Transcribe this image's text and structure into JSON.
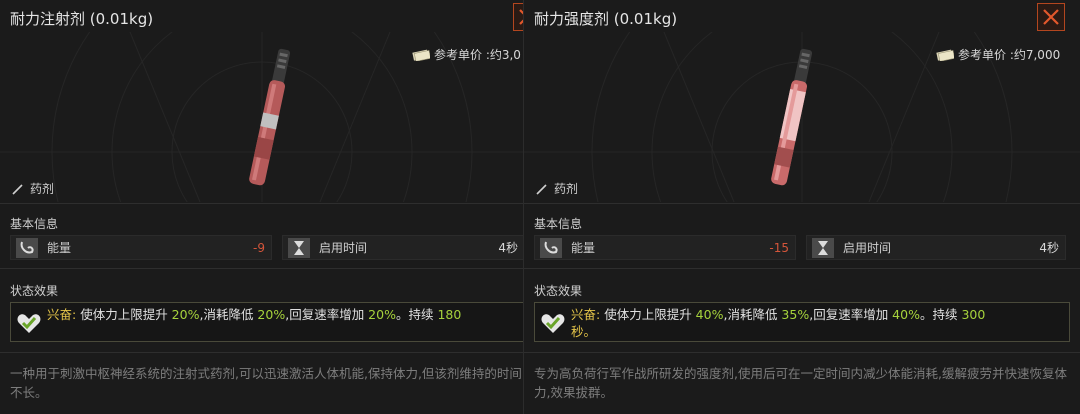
{
  "items": [
    {
      "title": "耐力注射剂 (0.01kg)",
      "price_label": "参考单价 :约3,0",
      "category": "药剂",
      "section_basic": "基本信息",
      "stat1_name": "能量",
      "stat1_value": "-9",
      "stat2_name": "启用时间",
      "stat2_value": "4秒",
      "section_effect": "状态效果",
      "effect_name": "兴奋:",
      "effect_text1": " 使体力上限提升 ",
      "effect_v1": "20%",
      "effect_text2": ",消耗降低 ",
      "effect_v2": "20%",
      "effect_text3": ",回复速率增加 ",
      "effect_v3": "20%",
      "effect_text4": "。持续 ",
      "effect_v4": "180",
      "effect_line2": "",
      "desc": "一种用于刺激中枢神经系统的注射式药剂,可以迅速激活人体机能,保持体力,但该剂维持的时间不长。"
    },
    {
      "title": "耐力强度剂 (0.01kg)",
      "price_label": "参考单价 :约7,000",
      "category": "药剂",
      "section_basic": "基本信息",
      "stat1_name": "能量",
      "stat1_value": "-15",
      "stat2_name": "启用时间",
      "stat2_value": "4秒",
      "section_effect": "状态效果",
      "effect_name": "兴奋:",
      "effect_text1": " 使体力上限提升 ",
      "effect_v1": "40%",
      "effect_text2": ",消耗降低 ",
      "effect_v2": "35%",
      "effect_text3": ",回复速率增加 ",
      "effect_v3": "40%",
      "effect_text4": "。持续 ",
      "effect_v4": "300",
      "effect_line2": "秒。",
      "desc": "专为高负荷行军作战所研发的强度剂,使用后可在一定时间内减少体能消耗,缓解疲劳并快速恢复体力,效果拔群。"
    }
  ],
  "colors": {
    "accent_close": "#b3461f",
    "negative": "#d4553a",
    "positive": "#a6d23c",
    "effect_name": "#e6c64a"
  }
}
